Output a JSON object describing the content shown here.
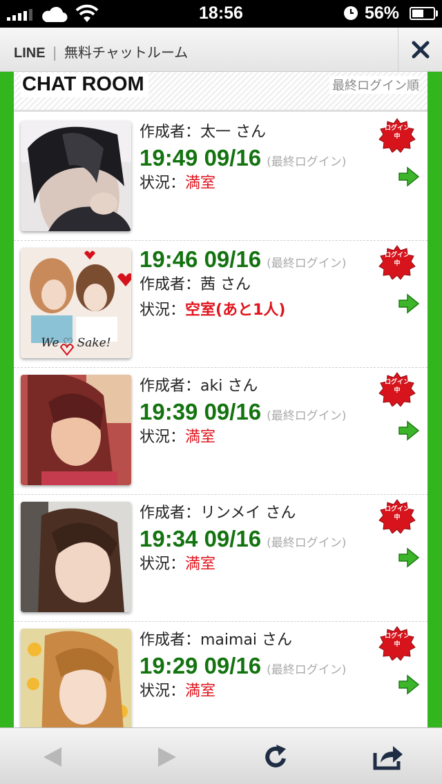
{
  "status_bar": {
    "time": "18:56",
    "battery_percent": "56%",
    "battery_level": 0.56,
    "icons": [
      "signal-icon",
      "cloud-icon",
      "wifi-icon",
      "clock-icon",
      "battery-icon"
    ]
  },
  "title_bar": {
    "brand": "LINE",
    "separator": "|",
    "title": "無料チャットルーム",
    "close_icon": "close-icon"
  },
  "header": {
    "title": "CHAT ROOM",
    "sort_label": "最終ログイン順"
  },
  "colors": {
    "frame_green": "#33b51e",
    "time_green": "#13730f",
    "status_red": "#e0141e",
    "badge_red": "#d7141c",
    "arrow_green": "#3db52a"
  },
  "rooms": [
    {
      "creator": "作成者：太一 さん",
      "login_time": "19:49 09/16",
      "login_note": "(最終ログイン)",
      "status_label": "状況：",
      "status_value": "満室",
      "badge_top": "ログイン",
      "badge_bottom": "中",
      "avatar": "avatar-photo"
    },
    {
      "creator": "作成者：茜 さん",
      "login_time": "19:46 09/16",
      "login_note": "(最終ログイン)",
      "status_label": "状況：",
      "status_value": "空室(あと1人)",
      "badge_top": "ログイン",
      "badge_bottom": "中",
      "avatar": "avatar-photo",
      "avatar_caption": "We ♡ Sake!"
    },
    {
      "creator": "作成者：aki さん",
      "login_time": "19:39 09/16",
      "login_note": "(最終ログイン)",
      "status_label": "状況：",
      "status_value": "満室",
      "badge_top": "ログイン",
      "badge_bottom": "中",
      "avatar": "avatar-photo"
    },
    {
      "creator": "作成者：リンメイ さん",
      "login_time": "19:34 09/16",
      "login_note": "(最終ログイン)",
      "status_label": "状況：",
      "status_value": "満室",
      "badge_top": "ログイン",
      "badge_bottom": "中",
      "avatar": "avatar-photo"
    },
    {
      "creator": "作成者：maimai さん",
      "login_time": "19:29 09/16",
      "login_note": "(最終ログイン)",
      "status_label": "状況：",
      "status_value": "満室",
      "badge_top": "ログイン",
      "badge_bottom": "中",
      "avatar": "avatar-photo"
    }
  ],
  "toolbar": {
    "icons": [
      "back-arrow-icon",
      "forward-arrow-icon",
      "reload-icon",
      "share-icon"
    ]
  }
}
